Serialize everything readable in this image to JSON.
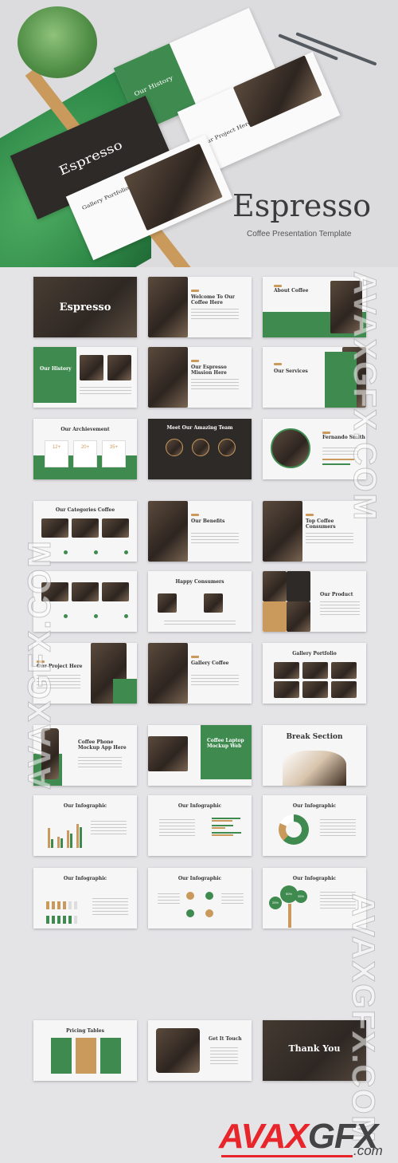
{
  "hero": {
    "title": "Espresso",
    "subtitle": "Coffee Presentation Template",
    "mockup_slides": [
      "Our History",
      "Espresso",
      "Our Project Here",
      "Gallery Portfolio"
    ]
  },
  "colors": {
    "green": "#3e8a4f",
    "tan": "#c99a5c",
    "dark": "#2e2a27",
    "background": "#e4e3e6"
  },
  "slides": [
    {
      "title": "Espresso",
      "type": "dark"
    },
    {
      "title": "Welcome To Our Coffee Here",
      "type": "photoL"
    },
    {
      "title": "About Coffee",
      "type": "about"
    },
    {
      "title": "Our History",
      "type": "greenL"
    },
    {
      "title": "Our Espresso Mission Here",
      "type": "photoL"
    },
    {
      "title": "Our Services",
      "type": "greenR"
    },
    {
      "title": "Our Archievement",
      "type": "stats",
      "stats": [
        "12+",
        "20+",
        "35+"
      ]
    },
    {
      "title": "Meet Our Amazing Team",
      "type": "team"
    },
    {
      "title": "Fernando Smith",
      "type": "profile"
    },
    {
      "title": "Our Categories Coffee",
      "type": "cards"
    },
    {
      "title": "Our Benefits",
      "type": "photoL"
    },
    {
      "title": "Top Coffee Consumers",
      "type": "photoL"
    },
    {
      "title": "",
      "type": "cards"
    },
    {
      "title": "Happy Consumers",
      "type": "center"
    },
    {
      "title": "Our Product",
      "type": "product"
    },
    {
      "title": "Our Project Here",
      "type": "photoR"
    },
    {
      "title": "Gallery Coffee",
      "type": "photoL"
    },
    {
      "title": "Gallery Portfolio",
      "type": "gallery"
    },
    {
      "title": "Coffee Phone Mockup App Here",
      "type": "phone"
    },
    {
      "title": "Coffee Laptop Mockup Web",
      "type": "laptop"
    },
    {
      "title": "Break Section",
      "type": "break"
    },
    {
      "title": "Our Infographic",
      "type": "bars"
    },
    {
      "title": "Our Infographic",
      "type": "hbars"
    },
    {
      "title": "Our Infographic",
      "type": "donut"
    },
    {
      "title": "Our Infographic",
      "type": "people"
    },
    {
      "title": "Our Infographic",
      "type": "cycle"
    },
    {
      "title": "Our Infographic",
      "type": "tree",
      "values": [
        "50%",
        "35%",
        "25%"
      ]
    },
    {
      "title": "Pricing Tables",
      "type": "pricing"
    },
    {
      "title": "Get It Touch",
      "type": "contact"
    },
    {
      "title": "Thank You",
      "type": "thanks"
    }
  ],
  "watermark": "AVAXGFX.COM",
  "logo": {
    "part1": "AVAX",
    "part2": "GFX",
    "suffix": ".com"
  }
}
